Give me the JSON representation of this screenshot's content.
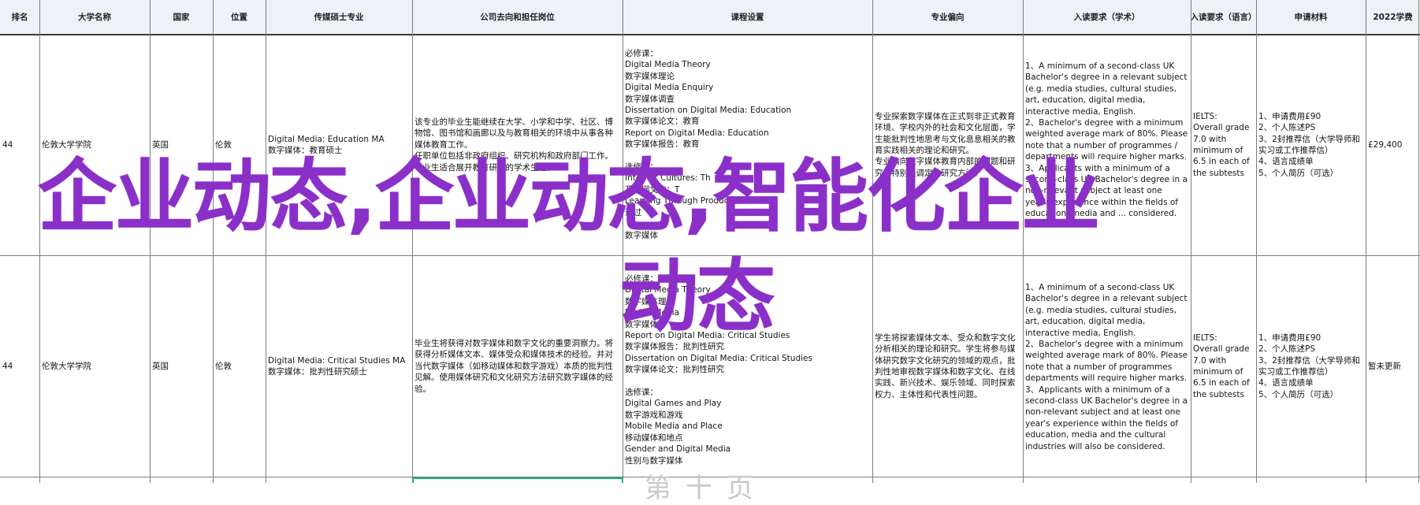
{
  "headers": [
    "排名",
    "大学名称",
    "国家",
    "位置",
    "传媒硕士专业",
    "公司去向和担任岗位",
    "课程设置",
    "专业偏向",
    "入读要求（学术）",
    "入读要求（语言）",
    "申请材料",
    "2022学费"
  ],
  "rows": [
    {
      "rank": "44",
      "university": "伦敦大学学院",
      "country": "英国",
      "location": "伦敦",
      "program": "Digital Media: Education MA\n数字媒体：教育硕士",
      "careers": "该专业的毕业生能继续在大学、小学和中学、社区、博物馆、图书馆和画廊以及与教育相关的环境中从事各种媒体教育工作。\n任职单位包括非政府组织、研究机构和政府部门工作。毕业生适合展开教育研究的学术生涯。",
      "courses": "必修课：\nDigital Media Theory\n数字媒体理论\nDigital Media Enquiry\n数字媒体调查\nDissertation on Digital Media: Education\n数字媒体论文：教育\nReport on Digital Media: Education\n数字媒体报告：教育\n\n选修课：\nInternet Cultures: Th\n互联网文化：T\nLearning Through Production\n通过\n\n数字媒体",
      "focus": "专业探索数字媒体在正式到非正式教育环境、学校内外的社会和文化层面，学生能批判性地思考与文化息息相关的教育实践相关的理论和研究。\n专业偏向数字媒体教育内部的问题和研究，特别强调定性研究方法。",
      "academic": "1、A minimum of a second-class UK Bachelor's degree in a relevant subject (e.g. media studies, cultural studies, art, education, digital media, interactive media, English.\n2、Bachelor's degree with a minimum weighted average mark of 80%. Please note that a number of programmes / departments will require higher marks.\n3、Applicants with a minimum of a second-class UK Bachelor's degree in a non-relevant subject at least one year's experience within the fields of education, media and ... considered.",
      "language": "IELTS:\nOverall grade 7.0 with minimum of 6.5 in each of the subtests",
      "materials": "1、申请费用£90\n2、个人陈述PS\n3、2封推荐信（大学导师和实习或工作推荐信）\n4、语言成绩单\n5、个人简历（可选）",
      "tuition": "£29,400"
    },
    {
      "rank": "44",
      "university": "伦敦大学学院",
      "country": "英国",
      "location": "伦敦",
      "program": "Digital Media: Critical Studies MA\n数字媒体：批判性研究硕士",
      "careers": "毕业生将获得对数字媒体和数字文化的重要洞察力。将获得分析媒体文本、媒体受众和媒体技术的经验。并对当代数字媒体（如移动媒体和数字游戏）本质的批判性见解。使用媒体研究和文化研究方法研究数字媒体的经验。",
      "courses": "必修课：\nDigital Media Theory\n数字媒体理论\nDigital Media\n数字媒体\nReport on Digital Media: Critical Studies\n数字媒体报告：批判性研究\nDissertation on Digital Media: Critical Studies\n数字媒体论文：批判性研究\n\n选修课：\nDigital Games and Play\n数字游戏和游戏\nMobile Media and Place\n移动媒体和地点\nGender and Digital Media\n性别与数字媒体",
      "focus": "学生将探索媒体文本、受众和数字文化分析相关的理论和研究。学生将参与媒体研究数字文化研究的领域的观点，批判性地审视数字媒体和数字文化、在线实践、新兴技术、娱乐领域、同时探索权力、主体性和代表性问题。",
      "academic": "1、A minimum of a second-class UK Bachelor's degree in a relevant subject (e.g. media studies, cultural studies, art, education, digital media, interactive media, English.\n2、Bachelor's degree with a minimum weighted average mark of 80%. Please note that a number of programmes departments will require higher marks.\n3、Applicants with a minimum of a second-class UK Bachelor's degree in a non-relevant subject and at least one year's experience within the fields of education, media and the cultural industries will also be considered.",
      "language": "IELTS:\nOverall grade 7.0 with minimum of 6.5 in each of the subtests",
      "materials": "1、申请费用£90\n2、个人陈述PS\n3、2封推荐信（大学导师和实习或工作推荐信）\n4、语言成绩单\n5、个人简历（可选）",
      "tuition": "暂未更新"
    }
  ],
  "watermark": {
    "line1": "企业动态,企业动态,智能化企业",
    "line2": "动态"
  },
  "ghost_text": "第十页",
  "colors": {
    "watermark": "#8b2fc9",
    "header_bg": "#eef1f6",
    "grid": "#7d7d7d",
    "selection": "#1fae73"
  }
}
